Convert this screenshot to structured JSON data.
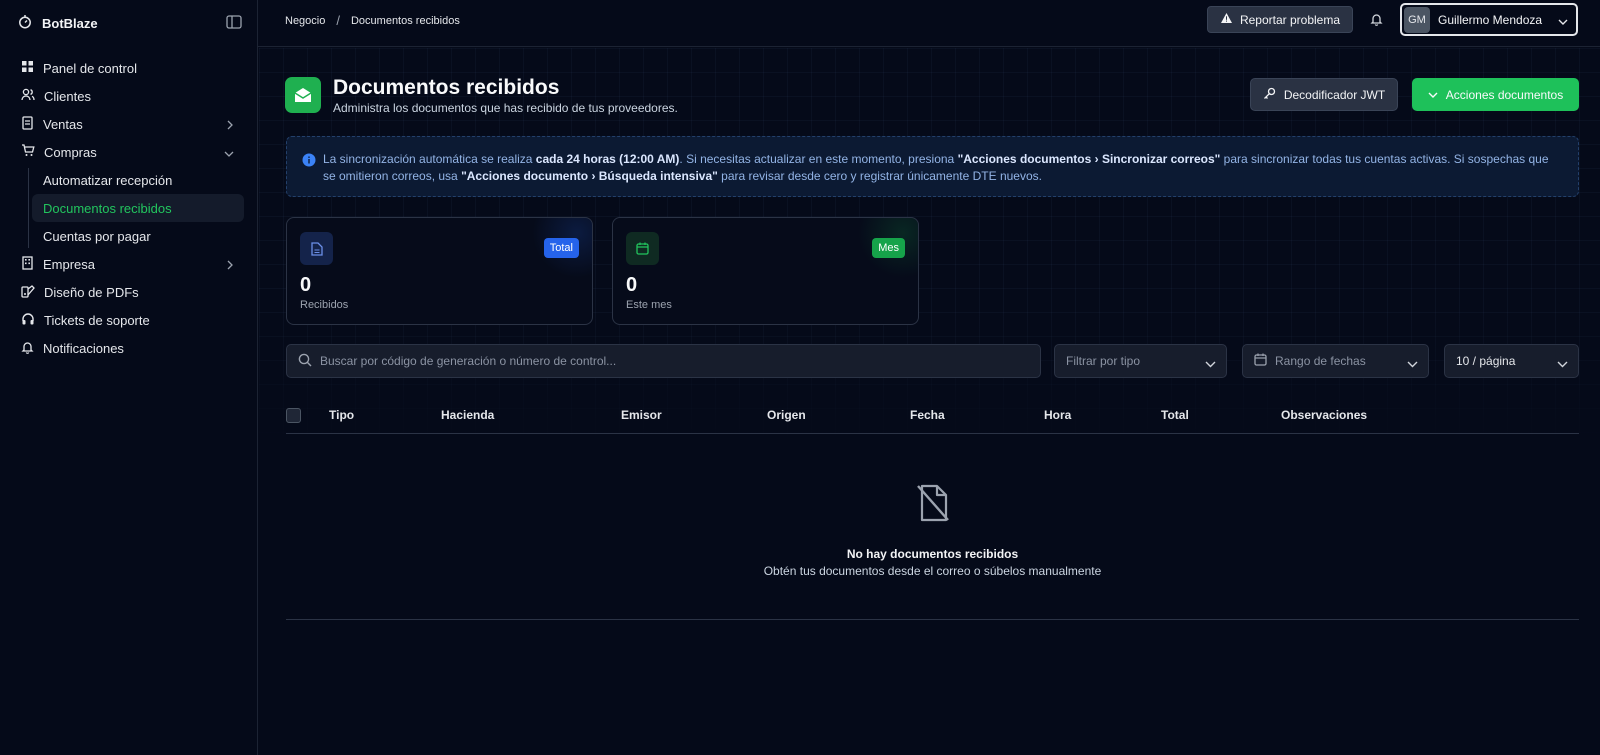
{
  "app": {
    "name": "BotBlaze"
  },
  "sidebar": {
    "items": [
      {
        "label": "Panel de control",
        "icon": "grid-icon"
      },
      {
        "label": "Clientes",
        "icon": "users-icon"
      },
      {
        "label": "Ventas",
        "icon": "receipt-icon"
      },
      {
        "label": "Compras",
        "icon": "cart-icon"
      },
      {
        "label": "Empresa",
        "icon": "building-icon"
      },
      {
        "label": "Diseño de PDFs",
        "icon": "palette-icon"
      },
      {
        "label": "Tickets de soporte",
        "icon": "headset-icon"
      },
      {
        "label": "Notificaciones",
        "icon": "bell-icon"
      }
    ],
    "compras_sub": [
      {
        "label": "Automatizar recepción"
      },
      {
        "label": "Documentos recibidos"
      },
      {
        "label": "Cuentas por pagar"
      }
    ]
  },
  "topbar": {
    "breadcrumb": [
      "Negocio",
      "/",
      "Documentos recibidos"
    ],
    "report_label": "Reportar problema",
    "user": {
      "initials": "GM",
      "name": "Guillermo Mendoza"
    }
  },
  "header": {
    "title": "Documentos recibidos",
    "subtitle": "Administra los documentos que has recibido de tus proveedores.",
    "jwt_label": "Decodificador JWT",
    "actions_label": "Acciones documentos"
  },
  "alert": {
    "t1": "La sincronización automática se realiza ",
    "b1": "cada 24 horas (12:00 AM)",
    "t2": ". Si necesitas actualizar en este momento, presiona ",
    "b2": "\"Acciones documentos › Sincronizar correos\"",
    "t3": " para sincronizar todas tus cuentas activas. Si sospechas que se omitieron correos, usa ",
    "b3": "\"Acciones documento › Búsqueda intensiva\"",
    "t4": " para revisar desde cero y registrar únicamente DTE nuevos."
  },
  "stats": [
    {
      "badge": "Total",
      "value": "0",
      "label": "Recibidos",
      "color": "#2563eb"
    },
    {
      "badge": "Mes",
      "value": "0",
      "label": "Este mes",
      "color": "#16a34a"
    }
  ],
  "filters": {
    "search_placeholder": "Buscar por código de generación o número de control...",
    "type_placeholder": "Filtrar por tipo",
    "date_placeholder": "Rango de fechas",
    "page_size": "10 / página"
  },
  "table": {
    "columns": [
      "Tipo",
      "Hacienda",
      "Emisor",
      "Origen",
      "Fecha",
      "Hora",
      "Total",
      "Observaciones"
    ],
    "empty_title": "No hay documentos recibidos",
    "empty_sub": "Obtén tus documentos desde el correo o súbelos manualmente"
  },
  "colors": {
    "accent": "#1ec15a",
    "background": "#050a19",
    "active_text": "#22c55e"
  }
}
